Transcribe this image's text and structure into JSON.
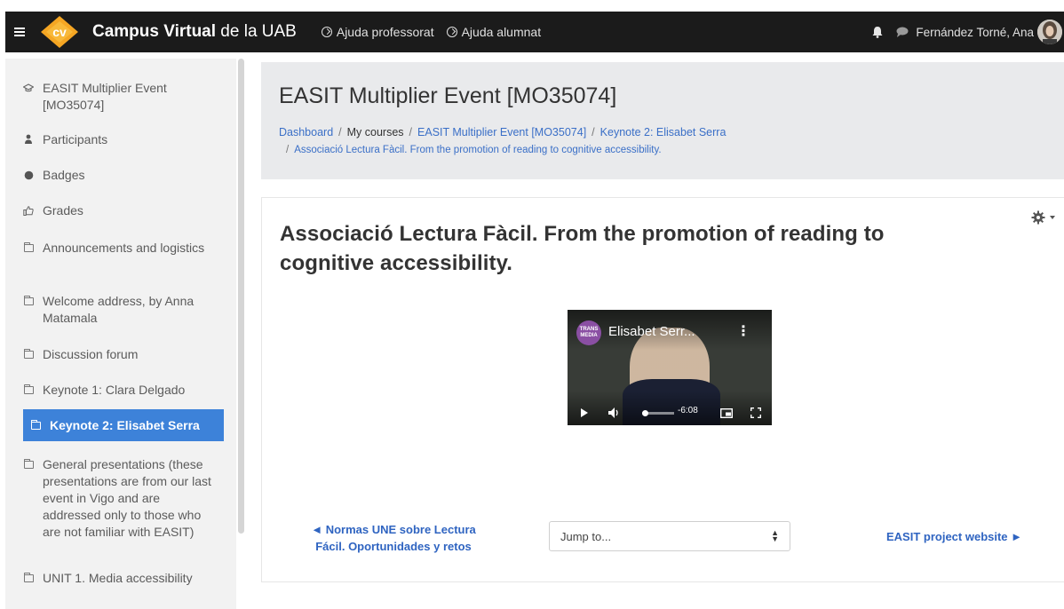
{
  "navbar": {
    "brand_bold": "Campus Virtual",
    "brand_rest": " de la UAB",
    "help_teacher": "Ajuda professorat",
    "help_student": "Ajuda alumnat",
    "user_name": "Fernández Torné, Ana"
  },
  "sidebar": {
    "items": [
      {
        "label": "EASIT Multiplier Event [MO35074]",
        "icon": "graduation-cap-icon"
      },
      {
        "label": "Participants",
        "icon": "users-icon"
      },
      {
        "label": "Badges",
        "icon": "badge-icon"
      },
      {
        "label": "Grades",
        "icon": "thumbs-up-icon"
      },
      {
        "label": "Announcements and logistics",
        "icon": "folder-icon"
      },
      {
        "label": "Welcome address, by Anna Matamala",
        "icon": "folder-icon"
      },
      {
        "label": "Discussion forum",
        "icon": "folder-icon"
      },
      {
        "label": "Keynote 1: Clara Delgado",
        "icon": "folder-icon"
      },
      {
        "label": "Keynote 2: Elisabet Serra",
        "icon": "folder-icon",
        "active": true
      },
      {
        "label": "General presentations (these presentations are from our last event in Vigo and are addressed only to those who are not familiar with EASIT)",
        "icon": "folder-icon"
      },
      {
        "label": "UNIT 1. Media accessibility",
        "icon": "folder-icon"
      }
    ]
  },
  "header": {
    "course_title": "EASIT Multiplier Event [MO35074]",
    "breadcrumb": {
      "dashboard": "Dashboard",
      "my_courses": "My courses",
      "course": "EASIT Multiplier Event [MO35074]",
      "section": "Keynote 2: Elisabet Serra",
      "page": "Associació Lectura Fàcil. From the promotion of reading to cognitive accessibility.",
      "separator": "/"
    }
  },
  "main": {
    "page_title": "Associació Lectura Fàcil. From the promotion of reading to cognitive accessibility.",
    "video": {
      "channel_badge": "TRANS MEDIA",
      "title": "Elisabet Serr...",
      "time": "-6:08"
    },
    "prev_link": "◄ Normas UNE sobre Lectura Fácil. Oportunidades y retos",
    "jump_placeholder": "Jump to...",
    "next_link": "EASIT project website ►"
  },
  "colors": {
    "navbar_bg": "#1b1b1b",
    "accent": "#3d82d9",
    "link": "#3a6fc7",
    "logo_orange": "#f5a623"
  }
}
